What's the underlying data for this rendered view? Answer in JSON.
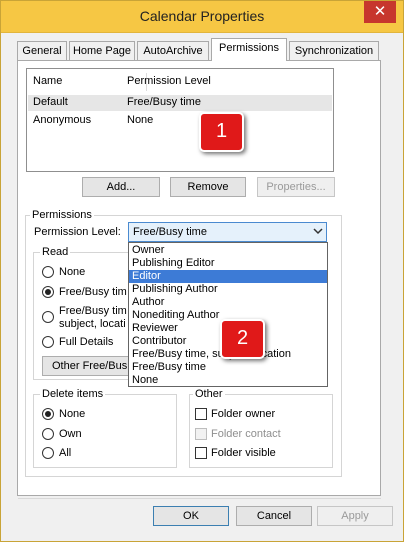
{
  "window": {
    "title": "Calendar Properties",
    "close_glyph": "✕"
  },
  "tabs": [
    {
      "label": "General"
    },
    {
      "label": "Home Page"
    },
    {
      "label": "AutoArchive"
    },
    {
      "label": "Permissions"
    },
    {
      "label": "Synchronization"
    }
  ],
  "permissions_list": {
    "columns": [
      "Name",
      "Permission Level"
    ],
    "rows": [
      {
        "name": "Default",
        "level": "Free/Busy time"
      },
      {
        "name": "Anonymous",
        "level": "None"
      }
    ]
  },
  "list_buttons": {
    "add": "Add...",
    "remove": "Remove",
    "properties": "Properties..."
  },
  "permissions_group": {
    "title": "Permissions",
    "level_label": "Permission Level:",
    "selected_level": "Free/Busy time",
    "options": [
      "Owner",
      "Publishing Editor",
      "Editor",
      "Publishing Author",
      "Author",
      "Nonediting Author",
      "Reviewer",
      "Contributor",
      "Free/Busy time, subject, location",
      "Free/Busy time",
      "None"
    ],
    "highlighted_option": "Editor"
  },
  "read_group": {
    "title": "Read",
    "options_visible": [
      "None",
      "Free/Busy tim",
      "Free/Busy tim",
      "subject, locati",
      "Full Details"
    ],
    "other_button": "Other Free/Bus"
  },
  "delete_group": {
    "title": "Delete items",
    "options": [
      "None",
      "Own",
      "All"
    ]
  },
  "other_group": {
    "title": "Other",
    "options": [
      "Folder owner",
      "Folder contact",
      "Folder visible"
    ]
  },
  "footer_buttons": {
    "ok": "OK",
    "cancel": "Cancel",
    "apply": "Apply"
  },
  "callouts": {
    "one": "1",
    "two": "2"
  },
  "colors": {
    "titlebar": "#f6c744",
    "close": "#c7362d",
    "highlight": "#3d7bd6",
    "callout": "#e01919"
  }
}
